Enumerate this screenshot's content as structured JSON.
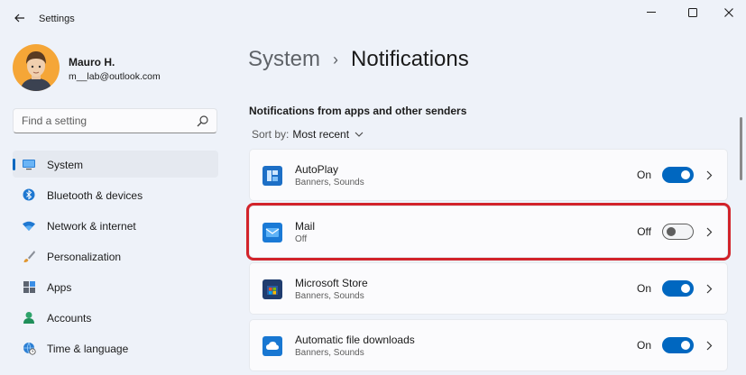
{
  "window": {
    "title": "Settings",
    "back_icon": "arrow-left-icon",
    "controls": [
      "minimize-icon",
      "maximize-icon",
      "close-icon"
    ]
  },
  "profile": {
    "name": "Mauro H.",
    "email": "m__lab@outlook.com"
  },
  "search": {
    "placeholder": "Find a setting",
    "value": ""
  },
  "sidebar": {
    "items": [
      {
        "label": "System",
        "icon": "monitor-icon",
        "selected": true
      },
      {
        "label": "Bluetooth & devices",
        "icon": "bluetooth-icon",
        "selected": false
      },
      {
        "label": "Network & internet",
        "icon": "wifi-icon",
        "selected": false
      },
      {
        "label": "Personalization",
        "icon": "brush-icon",
        "selected": false
      },
      {
        "label": "Apps",
        "icon": "apps-icon",
        "selected": false
      },
      {
        "label": "Accounts",
        "icon": "person-icon",
        "selected": false
      },
      {
        "label": "Time & language",
        "icon": "globe-clock-icon",
        "selected": false
      }
    ]
  },
  "breadcrumb": {
    "parent": "System",
    "separator": "›",
    "current": "Notifications"
  },
  "section": {
    "title": "Notifications from apps and other senders",
    "sort_label": "Sort by:",
    "sort_value": "Most recent"
  },
  "apps": [
    {
      "name": "AutoPlay",
      "subtitle": "Banners, Sounds",
      "state": "On",
      "enabled": true,
      "icon": "autoplay-icon"
    },
    {
      "name": "Mail",
      "subtitle": "Off",
      "state": "Off",
      "enabled": false,
      "icon": "mail-icon"
    },
    {
      "name": "Microsoft Store",
      "subtitle": "Banners, Sounds",
      "state": "On",
      "enabled": true,
      "icon": "store-icon"
    },
    {
      "name": "Automatic file downloads",
      "subtitle": "Banners, Sounds",
      "state": "On",
      "enabled": true,
      "icon": "cloud-icon"
    }
  ],
  "colors": {
    "accent": "#0067c0",
    "highlight": "#d2232a",
    "background": "#eef2f9"
  }
}
